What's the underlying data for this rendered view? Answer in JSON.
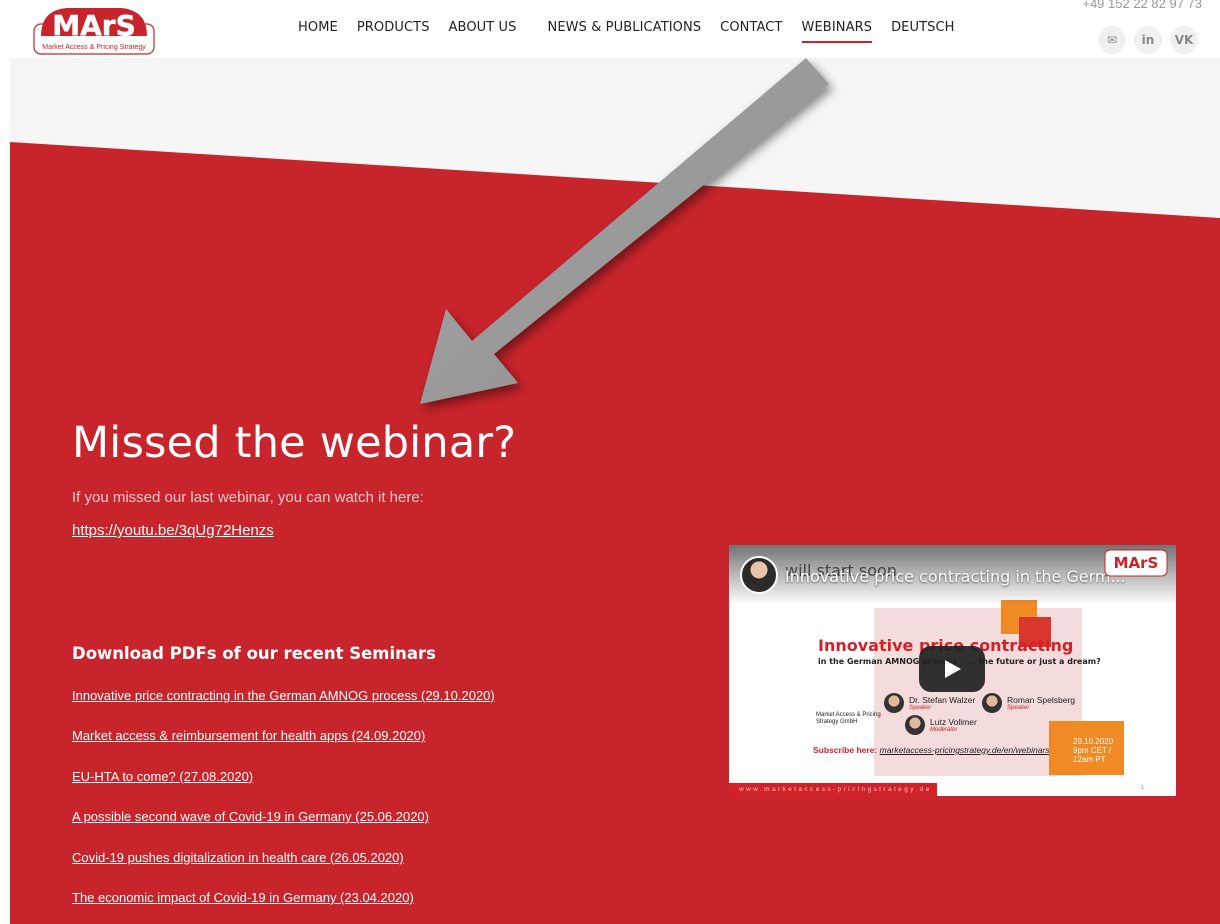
{
  "header": {
    "logo_text": "MArS",
    "logo_tagline": "Market Access & Pricing Strategy",
    "phone": "+49 152 22 82 97 73",
    "nav": [
      {
        "label": "HOME"
      },
      {
        "label": "PRODUCTS"
      },
      {
        "label": "ABOUT US"
      },
      {
        "label": "NEWS & PUBLICATIONS"
      },
      {
        "label": "CONTACT"
      },
      {
        "label": "WEBINARS",
        "active": true
      },
      {
        "label": "DEUTSCH"
      }
    ],
    "socials": [
      {
        "icon": "envelope-icon",
        "glyph": "✉"
      },
      {
        "icon": "linkedin-icon",
        "glyph": "in"
      },
      {
        "icon": "vk-icon",
        "glyph": "VK"
      }
    ]
  },
  "colors": {
    "brand_red": "#c8242b",
    "light_bg": "#f6f6f6",
    "arrow_gray": "#9a9a9a"
  },
  "main": {
    "title": "Missed the webinar?",
    "intro": "If you missed our last webinar, you can watch it here:",
    "link": "https://youtu.be/3qUg72Henzs",
    "pdf_heading": "Download PDFs of our recent Seminars",
    "pdfs": [
      {
        "label": "Innovative price contracting in the German AMNOG process (29.10.2020)"
      },
      {
        "label": "Market access & reimbursement for health apps (24.09.2020)"
      },
      {
        "label": "EU-HTA to come? (27.08.2020)"
      },
      {
        "label": "A possible second wave of Covid-19 in Germany (25.06.2020)"
      },
      {
        "label": "Covid-19 pushes digitalization in health care (26.05.2020)"
      },
      {
        "label": "The economic impact of Covid-19 in Germany (23.04.2020)"
      }
    ]
  },
  "video": {
    "title": "Innovative price contracting in the Germ...",
    "behind_text": "will start soon",
    "slide_title": "Innovative price contracting",
    "slide_subtitle": "in the German AMNOG process – ... the future or just a dream?",
    "speakers": [
      {
        "name": "Dr. Stefan Walzer",
        "role": "Speaker"
      },
      {
        "name": "Roman Spelsberg",
        "role": "Speaker"
      },
      {
        "name": "Lutz Vollmer",
        "role": "Moderator"
      }
    ],
    "company": "Market Access & Pricing Strategy GmbH",
    "subscribe_label": "Subscribe here:",
    "subscribe_url": "marketaccess-pricingstrategy.de/en/webinars",
    "date_lines": [
      "29.10.2020",
      "9pm CET /",
      "12am PT"
    ],
    "footer_url": "www.marketaccess-pricingstrategy.de",
    "page_number": "1"
  }
}
